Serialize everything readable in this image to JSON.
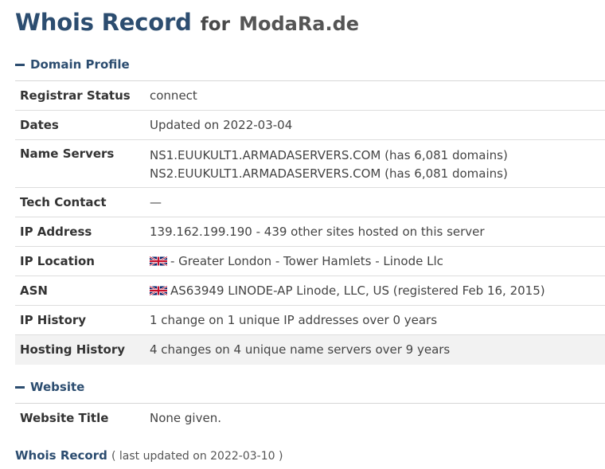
{
  "header": {
    "title": "Whois Record",
    "for_text": "for",
    "domain": "ModaRa.de"
  },
  "domain_profile": {
    "section_label": "Domain Profile",
    "rows": [
      {
        "label": "Registrar Status",
        "value": "connect"
      },
      {
        "label": "Dates",
        "value": "Updated on 2022-03-04"
      },
      {
        "label": "Name Servers",
        "lines": [
          "NS1.EUUKULT1.ARMADASERVERS.COM (has 6,081 domains)",
          "NS2.EUUKULT1.ARMADASERVERS.COM (has 6,081 domains)"
        ]
      },
      {
        "label": "Tech Contact",
        "value": "—"
      },
      {
        "label": "IP Address",
        "value": "139.162.199.190 - 439 other sites hosted on this server"
      },
      {
        "label": "IP Location",
        "value": "- Greater London - Tower Hamlets - Linode Llc",
        "flag_icon": "uk-flag-icon"
      },
      {
        "label": "ASN",
        "value": "AS63949 LINODE-AP Linode, LLC, US (registered Feb 16, 2015)",
        "flag_icon": "uk-flag-icon"
      },
      {
        "label": "IP History",
        "value": "1 change on 1 unique IP addresses over 0 years"
      },
      {
        "label": "Hosting History",
        "value": "4 changes on 4 unique name servers over 9 years"
      }
    ]
  },
  "website": {
    "section_label": "Website",
    "rows": [
      {
        "label": "Website Title",
        "value": "None given."
      }
    ]
  },
  "footer": {
    "link_text": "Whois Record",
    "note": "( last updated on 2022-03-10 )"
  },
  "colors": {
    "accent": "#2c4d70",
    "row_border": "#dddddd",
    "hover_row": "#f2f2f2"
  }
}
